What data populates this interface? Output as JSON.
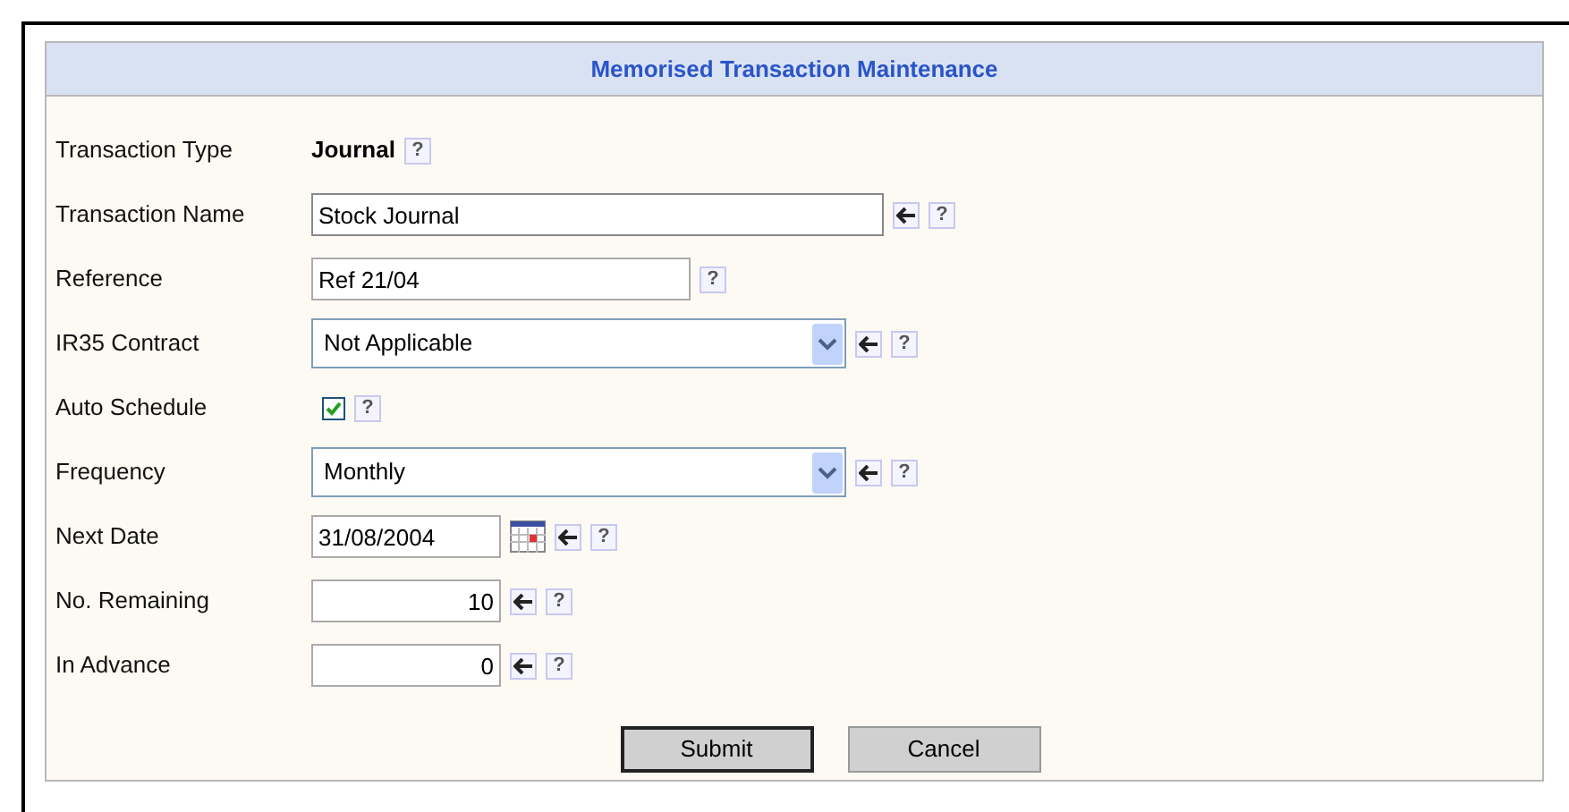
{
  "panel": {
    "title": "Memorised Transaction Maintenance"
  },
  "rows": [
    {
      "kind": "static",
      "label": "Transaction Type",
      "value": "Journal",
      "help": "?",
      "reset": false
    },
    {
      "kind": "wide_text",
      "label": "Transaction Name",
      "value": "Stock Journal",
      "help": "?",
      "reset": true,
      "focused": true
    },
    {
      "kind": "text",
      "label": "Reference",
      "value": "Ref 21/04",
      "help": "?",
      "reset": false,
      "focused": false
    },
    {
      "kind": "select",
      "label": "IR35 Contract",
      "value": "Not Applicable",
      "help": "?",
      "reset": true
    },
    {
      "kind": "checkbox",
      "label": "Auto Schedule",
      "checked": true,
      "help": "?",
      "reset": false
    },
    {
      "kind": "select",
      "label": "Frequency",
      "value": "Monthly",
      "help": "?",
      "reset": true
    },
    {
      "kind": "date",
      "label": "Next Date",
      "value": "31/08/2004",
      "help": "?",
      "reset": true
    },
    {
      "kind": "number",
      "label": "No. Remaining",
      "value": "10",
      "help": "?",
      "reset": true
    },
    {
      "kind": "number",
      "label": "In Advance",
      "value": "0",
      "help": "?",
      "reset": true
    }
  ],
  "buttons": [
    {
      "label": "Submit",
      "default": true
    },
    {
      "label": "Cancel",
      "default": false
    }
  ]
}
